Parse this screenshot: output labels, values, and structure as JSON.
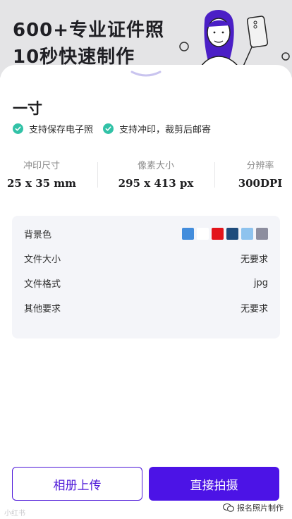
{
  "banner": {
    "line1": "600+专业证件照",
    "line2": "10秒快速制作"
  },
  "sheet": {
    "title": "一寸",
    "features": [
      {
        "text": "支持保存电子照",
        "icon": "check-circle-icon"
      },
      {
        "text": "支持冲印，裁剪后邮寄",
        "icon": "check-circle-icon"
      }
    ],
    "specs": [
      {
        "label": "冲印尺寸",
        "value": "25 x 35 mm"
      },
      {
        "label": "像素大小",
        "value": "295 x 413 px"
      },
      {
        "label": "分辨率",
        "value": "300DPI"
      }
    ],
    "info": {
      "background_label": "背景色",
      "background_colors": [
        "#438ddc",
        "#ffffff",
        "#e3141b",
        "#1f4c7c",
        "#8ec3ee",
        "#8d8e9f"
      ],
      "rows": [
        {
          "label": "文件大小",
          "value": "无要求"
        },
        {
          "label": "文件格式",
          "value": "jpg"
        },
        {
          "label": "其他要求",
          "value": "无要求"
        }
      ]
    }
  },
  "actions": {
    "album_upload": "相册上传",
    "shoot_now": "直接拍摄"
  },
  "watermarks": {
    "left": "小红书",
    "right": "报名照片制作"
  },
  "colors": {
    "accent": "#4c13e6",
    "check": "#32c2a7"
  }
}
